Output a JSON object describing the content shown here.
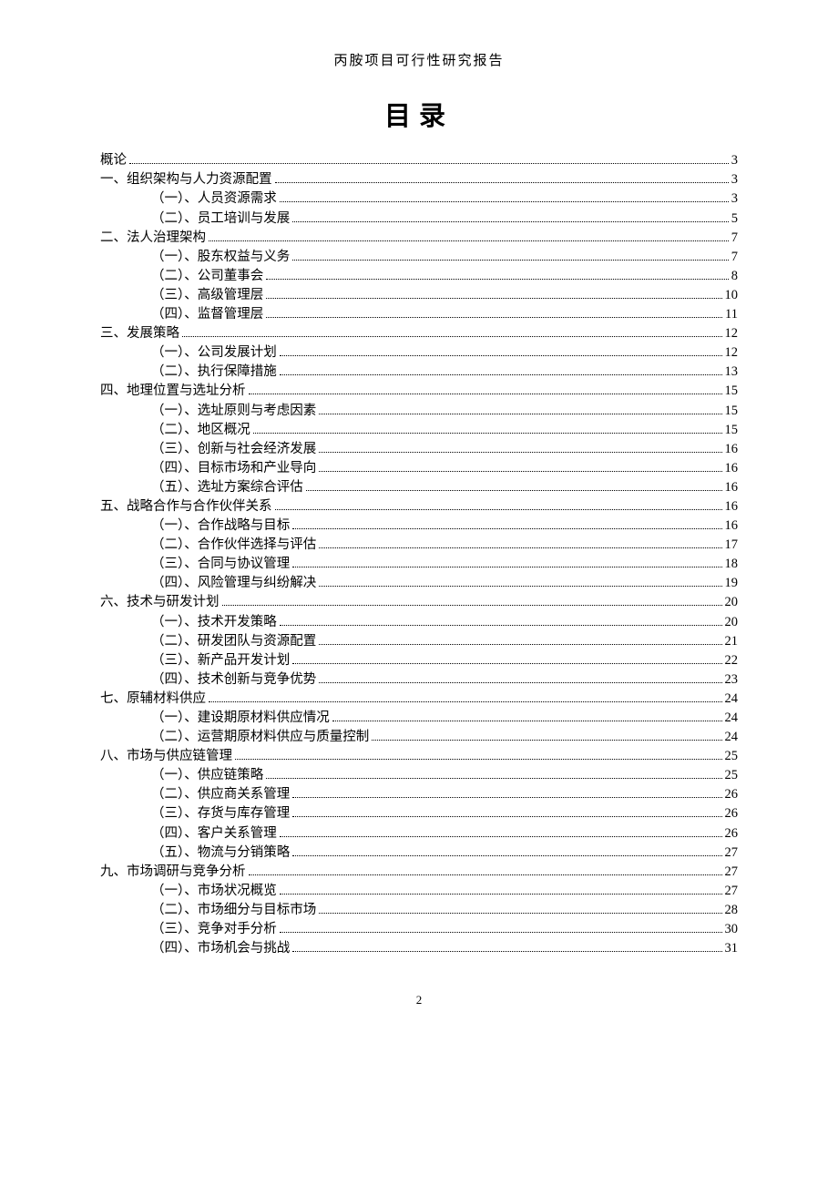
{
  "header": "丙胺项目可行性研究报告",
  "title": "目录",
  "pageNumber": "2",
  "toc": [
    {
      "level": 0,
      "label": "概论",
      "page": "3"
    },
    {
      "level": 0,
      "label": "一、组织架构与人力资源配置",
      "page": "3"
    },
    {
      "level": 1,
      "label": "（一）、人员资源需求",
      "page": "3"
    },
    {
      "level": 1,
      "label": "（二）、员工培训与发展",
      "page": "5"
    },
    {
      "level": 0,
      "label": "二、法人治理架构",
      "page": "7"
    },
    {
      "level": 1,
      "label": "（一）、股东权益与义务",
      "page": "7"
    },
    {
      "level": 1,
      "label": "（二）、公司董事会",
      "page": "8"
    },
    {
      "level": 1,
      "label": "（三）、高级管理层",
      "page": "10"
    },
    {
      "level": 1,
      "label": "（四）、监督管理层",
      "page": "11"
    },
    {
      "level": 0,
      "label": "三、发展策略",
      "page": "12"
    },
    {
      "level": 1,
      "label": "（一）、公司发展计划",
      "page": "12"
    },
    {
      "level": 1,
      "label": "（二）、执行保障措施",
      "page": "13"
    },
    {
      "level": 0,
      "label": "四、地理位置与选址分析",
      "page": "15"
    },
    {
      "level": 1,
      "label": "（一）、选址原则与考虑因素",
      "page": "15"
    },
    {
      "level": 1,
      "label": "（二）、地区概况",
      "page": "15"
    },
    {
      "level": 1,
      "label": "（三）、创新与社会经济发展",
      "page": "16"
    },
    {
      "level": 1,
      "label": "（四）、目标市场和产业导向",
      "page": "16"
    },
    {
      "level": 1,
      "label": "（五）、选址方案综合评估",
      "page": "16"
    },
    {
      "level": 0,
      "label": "五、战略合作与合作伙伴关系",
      "page": "16"
    },
    {
      "level": 1,
      "label": "（一）、合作战略与目标",
      "page": "16"
    },
    {
      "level": 1,
      "label": "（二）、合作伙伴选择与评估",
      "page": "17"
    },
    {
      "level": 1,
      "label": "（三）、合同与协议管理",
      "page": "18"
    },
    {
      "level": 1,
      "label": "（四）、风险管理与纠纷解决",
      "page": "19"
    },
    {
      "level": 0,
      "label": "六、技术与研发计划",
      "page": "20"
    },
    {
      "level": 1,
      "label": "（一）、技术开发策略",
      "page": "20"
    },
    {
      "level": 1,
      "label": "（二）、研发团队与资源配置",
      "page": "21"
    },
    {
      "level": 1,
      "label": "（三）、新产品开发计划",
      "page": "22"
    },
    {
      "level": 1,
      "label": "（四）、技术创新与竞争优势",
      "page": "23"
    },
    {
      "level": 0,
      "label": "七、原辅材料供应",
      "page": "24"
    },
    {
      "level": 1,
      "label": "（一）、建设期原材料供应情况",
      "page": "24"
    },
    {
      "level": 1,
      "label": "（二）、运营期原材料供应与质量控制",
      "page": "24"
    },
    {
      "level": 0,
      "label": "八、市场与供应链管理",
      "page": "25"
    },
    {
      "level": 1,
      "label": "（一）、供应链策略",
      "page": "25"
    },
    {
      "level": 1,
      "label": "（二）、供应商关系管理",
      "page": "26"
    },
    {
      "level": 1,
      "label": "（三）、存货与库存管理",
      "page": "26"
    },
    {
      "level": 1,
      "label": "（四）、客户关系管理",
      "page": "26"
    },
    {
      "level": 1,
      "label": "（五）、物流与分销策略",
      "page": "27"
    },
    {
      "level": 0,
      "label": "九、市场调研与竞争分析",
      "page": "27"
    },
    {
      "level": 1,
      "label": "（一）、市场状况概览",
      "page": "27"
    },
    {
      "level": 1,
      "label": "（二）、市场细分与目标市场",
      "page": "28"
    },
    {
      "level": 1,
      "label": "（三）、竞争对手分析",
      "page": "30"
    },
    {
      "level": 1,
      "label": "（四）、市场机会与挑战",
      "page": "31"
    }
  ]
}
